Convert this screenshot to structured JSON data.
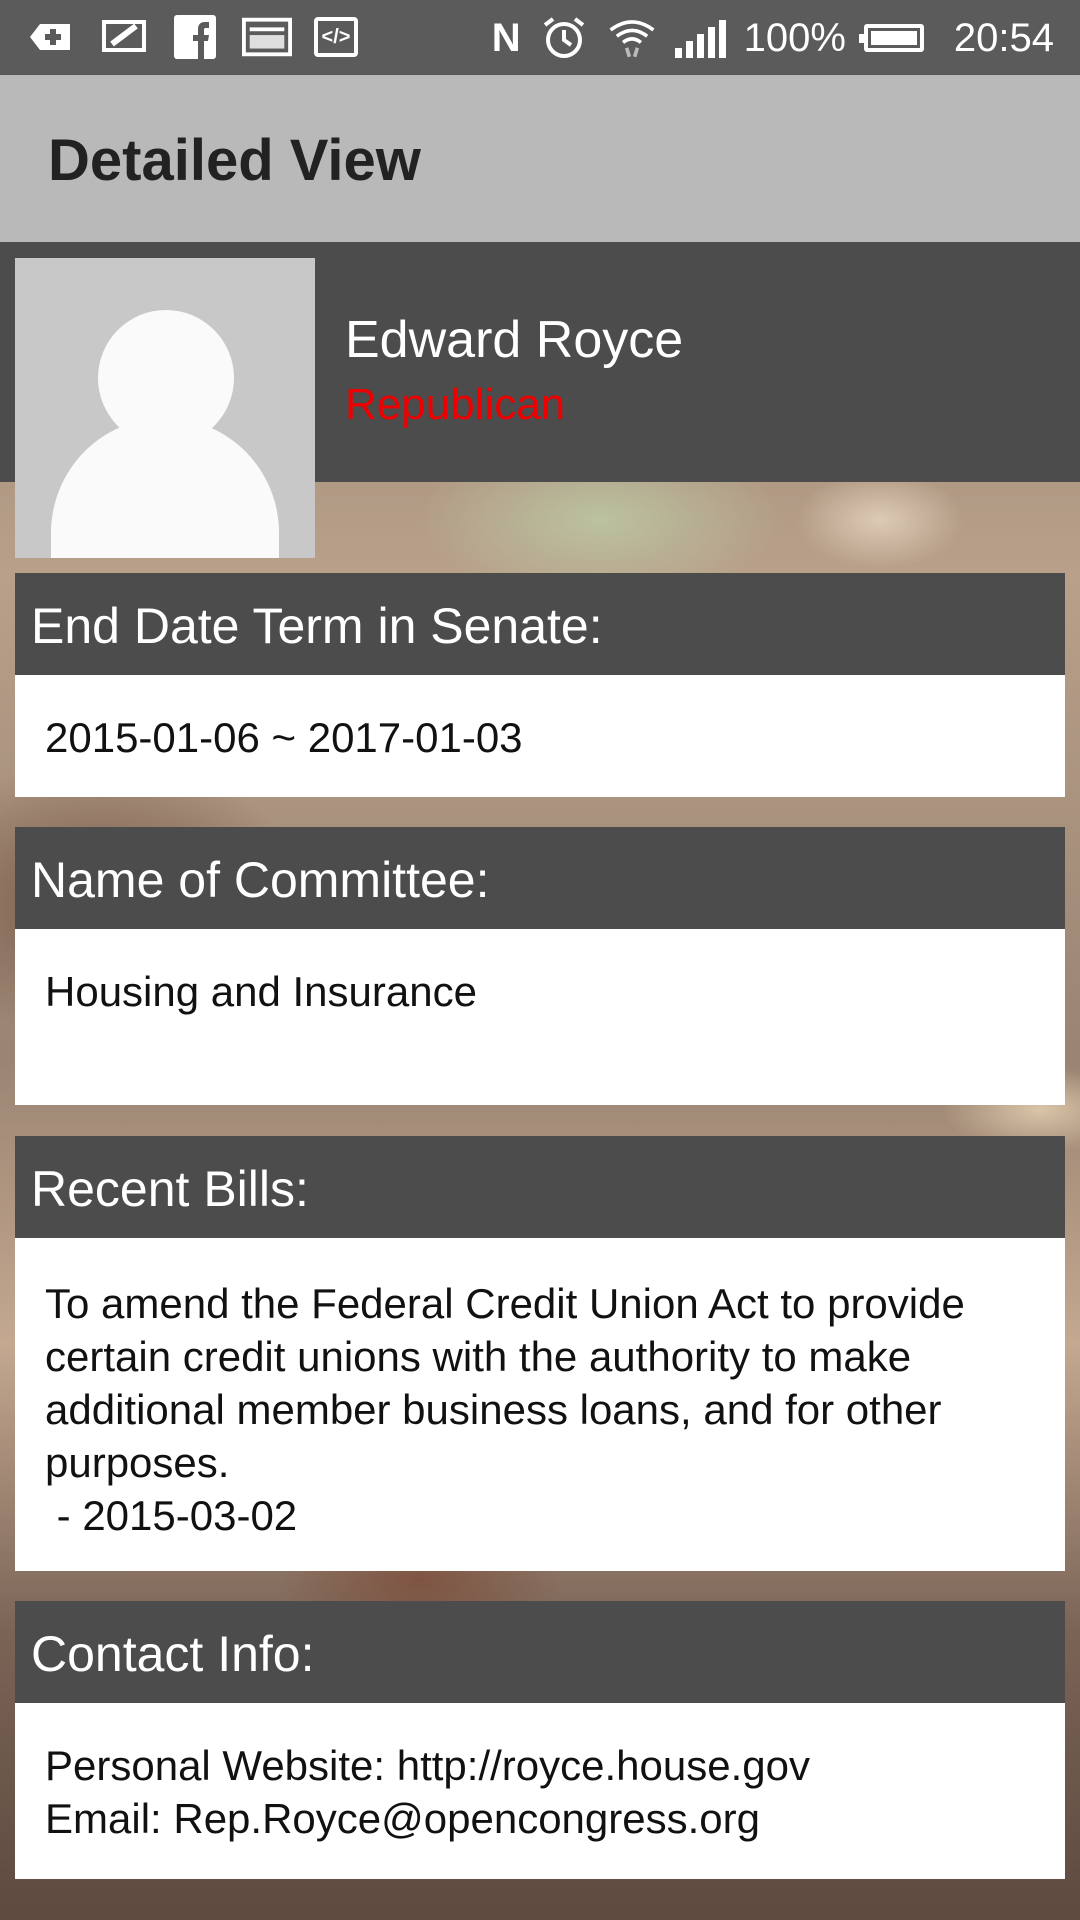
{
  "status_bar": {
    "left_icons": [
      "add-box-icon",
      "chat-icon",
      "facebook-icon",
      "image-icon",
      "code-icon"
    ],
    "nfc": "N",
    "battery_percent": "100%",
    "time": "20:54"
  },
  "action_bar": {
    "title": "Detailed View"
  },
  "profile": {
    "name": "Edward Royce",
    "party": "Republican",
    "party_color": "#ee0000",
    "avatar": "placeholder-person-icon"
  },
  "sections": [
    {
      "header": "End Date Term in Senate:",
      "lines": [
        "2015-01-06 ~ 2017-01-03"
      ]
    },
    {
      "header": "Name of Committee:",
      "lines": [
        "Housing and Insurance"
      ]
    },
    {
      "header": "Recent Bills:",
      "lines": [
        "To amend the Federal Credit Union Act to provide",
        "certain credit unions with the authority to make",
        "additional member business loans, and for other",
        "purposes.",
        " - 2015-03-02"
      ]
    },
    {
      "header": "Contact Info:",
      "lines": [
        "Personal Website: http://royce.house.gov",
        "Email: Rep.Royce@opencongress.org"
      ]
    }
  ]
}
